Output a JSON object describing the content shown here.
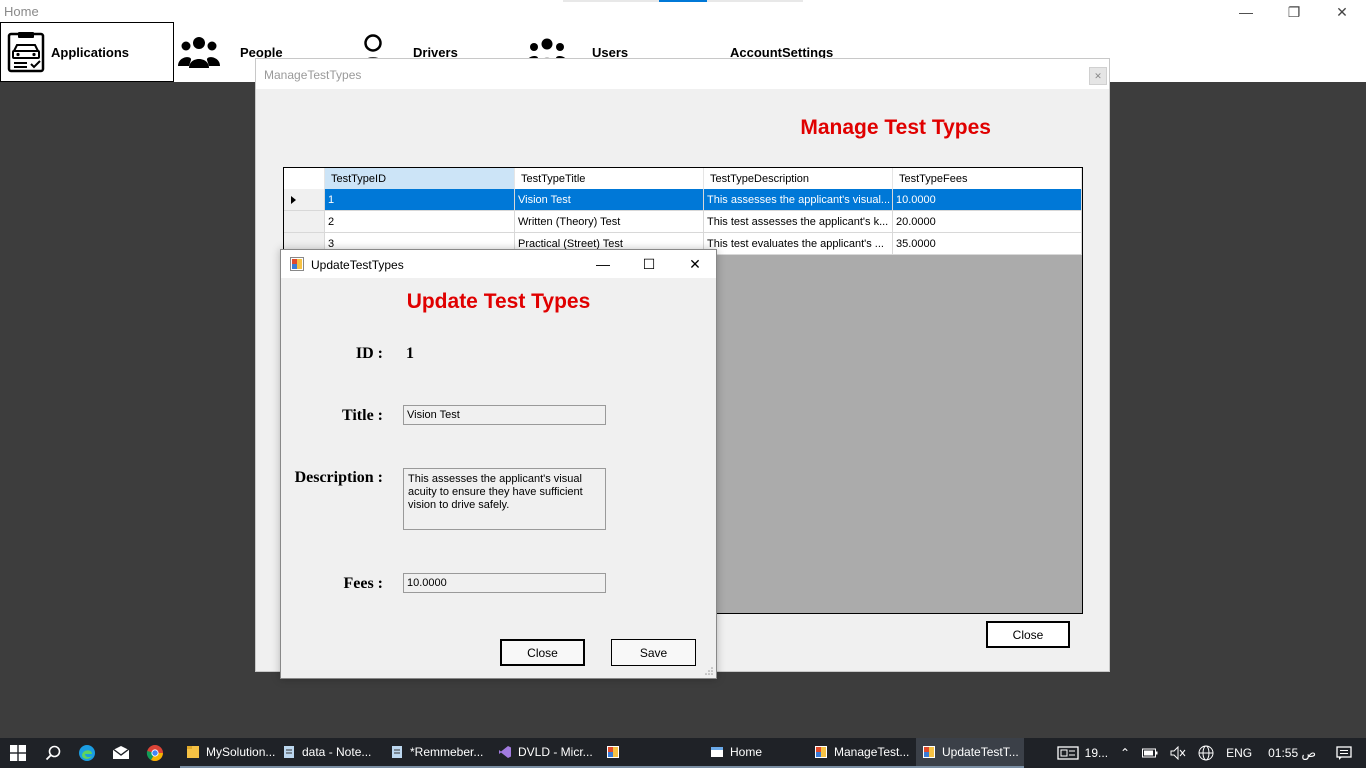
{
  "home": {
    "title": "Home",
    "controls": {
      "minimize": "—",
      "restore": "❐",
      "close": "✕"
    }
  },
  "nav": {
    "items": [
      {
        "label": "Applications",
        "icon": "applications-icon"
      },
      {
        "label": "People",
        "icon": "people-icon"
      },
      {
        "label": "Drivers",
        "icon": "driver-icon"
      },
      {
        "label": "Users",
        "icon": "users-icon"
      },
      {
        "label": "AccountSettings",
        "icon": ""
      }
    ]
  },
  "manage": {
    "window_title": "ManageTestTypes",
    "heading": "Manage Test Types",
    "columns": [
      "TestTypeID",
      "TestTypeTitle",
      "TestTypeDescription",
      "TestTypeFees"
    ],
    "rows": [
      {
        "id": "1",
        "title": "Vision Test",
        "description": "This assesses the applicant's visual...",
        "fees": "10.0000"
      },
      {
        "id": "2",
        "title": "Written (Theory) Test",
        "description": "This test assesses the applicant's k...",
        "fees": "20.0000"
      },
      {
        "id": "3",
        "title": "Practical (Street) Test",
        "description": "This test evaluates the applicant's ...",
        "fees": "35.0000"
      }
    ],
    "close_label": "Close"
  },
  "update": {
    "window_title": "UpdateTestTypes",
    "heading": "Update Test Types",
    "id_label": "ID :",
    "id_value": "1",
    "title_label": "Title :",
    "title_value": "Vision Test",
    "description_label": "Description :",
    "description_value": "This assesses the applicant's visual acuity to ensure they have sufficient vision to drive safely.",
    "fees_label": "Fees :",
    "fees_value": "10.0000",
    "close_label": "Close",
    "save_label": "Save"
  },
  "taskbar": {
    "tasks": [
      {
        "label": "MySolution...",
        "icon": "folder-icon"
      },
      {
        "label": "data - Note...",
        "icon": "notepad-icon"
      },
      {
        "label": "*Remmeber...",
        "icon": "notepad-icon"
      },
      {
        "label": "DVLD - Micr...",
        "icon": "visual-studio-icon"
      },
      {
        "label": "",
        "icon": "app-icon"
      },
      {
        "label": "Home",
        "icon": "window-icon"
      },
      {
        "label": "ManageTest...",
        "icon": "app-icon"
      },
      {
        "label": "UpdateTestT...",
        "icon": "app-icon"
      }
    ],
    "tray": {
      "news": "19...",
      "language": "ENG",
      "time": "01:55 ص"
    }
  }
}
